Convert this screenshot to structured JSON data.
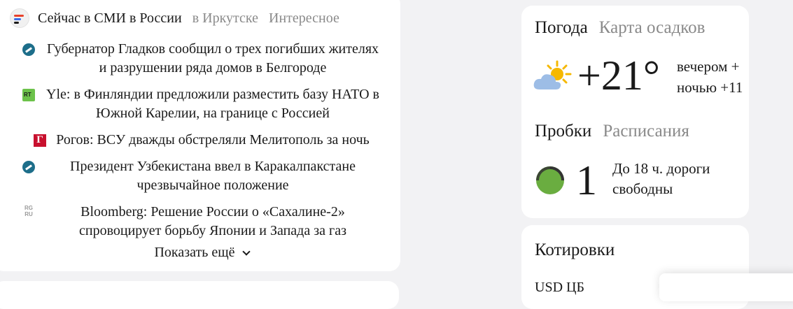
{
  "news": {
    "tabs": {
      "active": "Сейчас в СМИ в России",
      "region": "в Иркутске",
      "interesting": "Интересное"
    },
    "items": [
      {
        "source_icon": "news-agency-round-icon",
        "text": "Губернатор Гладков сообщил о трех погибших жителях и разрушении ряда домов в Белгороде"
      },
      {
        "source_icon": "rt-icon",
        "text": "Yle: в Финляндии предложили разместить базу НАТО в Южной Карелии, на границе с Россией"
      },
      {
        "source_icon": "gazeta-g-icon",
        "text": "Рогов: ВСУ дважды обстреляли Мелитополь за ночь"
      },
      {
        "source_icon": "news-agency-round-icon",
        "text": "Президент Узбекистана ввел в Каракалпакстане чрезвычайное положение"
      },
      {
        "source_icon": "rg-ru-icon",
        "text": "Bloomberg: Решение России о «Сахалине-2» спровоцирует борьбу Японии и Запада за газ"
      }
    ],
    "show_more": "Показать ещё"
  },
  "weather": {
    "tab_active": "Погода",
    "tab_map": "Карта осадков",
    "icon": "partly-cloudy-icon",
    "temp_now": "+21°",
    "evening": "вечером +",
    "night": "ночью +11"
  },
  "traffic": {
    "tab_active": "Пробки",
    "tab_schedule": "Расписания",
    "icon": "traffic-light-green-icon",
    "level": "1",
    "description": "До 18 ч. дороги свободны"
  },
  "quotes": {
    "title": "Котировки",
    "ticker": "USD ЦБ"
  },
  "colors": {
    "background": "#f2f2f4",
    "card": "#ffffff",
    "text_primary": "#1a1a1a",
    "text_secondary": "#8a8a8a",
    "traffic_green": "#6aad40",
    "weather_sun": "#f5b800",
    "weather_cloud": "#9dbde6"
  }
}
